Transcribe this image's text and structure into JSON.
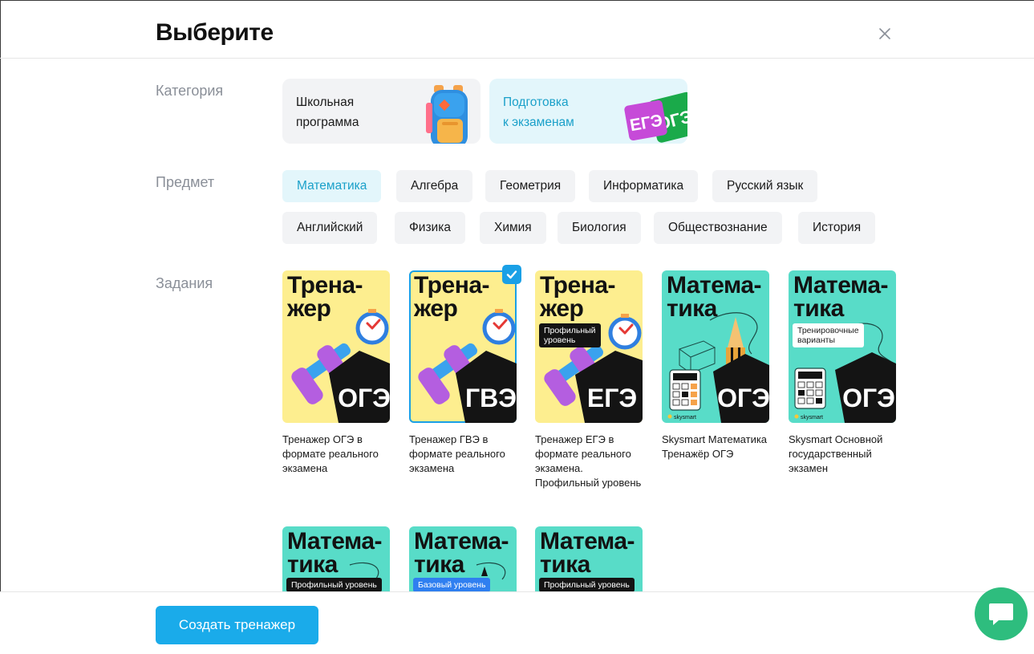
{
  "modal": {
    "title": "Выберите"
  },
  "labels": {
    "category": "Категория",
    "subject": "Предмет",
    "tasks": "Задания"
  },
  "categories": [
    {
      "label": "Школьная программа",
      "line1": "Школьная",
      "line2": "программа",
      "selected": false,
      "icon": "backpack-icon"
    },
    {
      "label": "Подготовка к экзаменам",
      "line1": "Подготовка",
      "line2": "к экзаменам",
      "selected": true,
      "icon": "exam-stickers-icon",
      "sticker1": "ЕГЭ",
      "sticker2": "ОГЭ"
    }
  ],
  "subjects": [
    {
      "label": "Математика",
      "active": true
    },
    {
      "label": "Алгебра",
      "active": false
    },
    {
      "label": "Геометрия",
      "active": false
    },
    {
      "label": "Информатика",
      "active": false
    },
    {
      "label": "Русский язык",
      "active": false
    },
    {
      "label": "Английский",
      "active": false
    },
    {
      "label": "Физика",
      "active": false
    },
    {
      "label": "Химия",
      "active": false
    },
    {
      "label": "Биология",
      "active": false
    },
    {
      "label": "Обществознание",
      "active": false
    },
    {
      "label": "История",
      "active": false
    }
  ],
  "tasks": [
    {
      "title_l1": "Трена-",
      "title_l2": "жер",
      "badge": "ОГЭ",
      "tag": "",
      "caption": "Тренажер ОГЭ в формате реального экзамена",
      "selected": false
    },
    {
      "title_l1": "Трена-",
      "title_l2": "жер",
      "badge": "ГВЭ",
      "tag": "",
      "caption": "Тренажер ГВЭ в формате реального экзамена",
      "selected": true
    },
    {
      "title_l1": "Трена-",
      "title_l2": "жер",
      "badge": "ЕГЭ",
      "tag": "Профильный уровень",
      "tag_l1": "Профильный",
      "tag_l2": "уровень",
      "caption": "Тренажер ЕГЭ в формате реального экзамена. Профильный уровень",
      "selected": false
    },
    {
      "title_l1": "Матема-",
      "title_l2": "тика",
      "badge": "ОГЭ",
      "tag": "",
      "brand": "skysmart",
      "caption": "Skysmart Математика Тренажёр ОГЭ",
      "selected": false
    },
    {
      "title_l1": "Матема-",
      "title_l2": "тика",
      "badge": "ОГЭ",
      "tag": "Тренировочные варианты",
      "tag_l1": "Тренировочные",
      "tag_l2": "варианты",
      "brand": "skysmart",
      "caption": "Skysmart Основной государственный экзамен",
      "selected": false
    },
    {
      "title_l1": "Матема-",
      "title_l2": "тика",
      "tag": "Профильный уровень",
      "caption": ""
    },
    {
      "title_l1": "Матема-",
      "title_l2": "тика",
      "tag": "Базовый уровень",
      "caption": ""
    },
    {
      "title_l1": "Матема-",
      "title_l2": "тика",
      "tag": "Профильный уровень",
      "caption": ""
    }
  ],
  "footer": {
    "create_label": "Создать тренажер"
  },
  "colors": {
    "accent": "#1aabea",
    "selected_text": "#1aa0c9",
    "chat": "#2ebd7e",
    "yellow_card": "#fdee8f",
    "teal_card": "#58dcc8"
  }
}
